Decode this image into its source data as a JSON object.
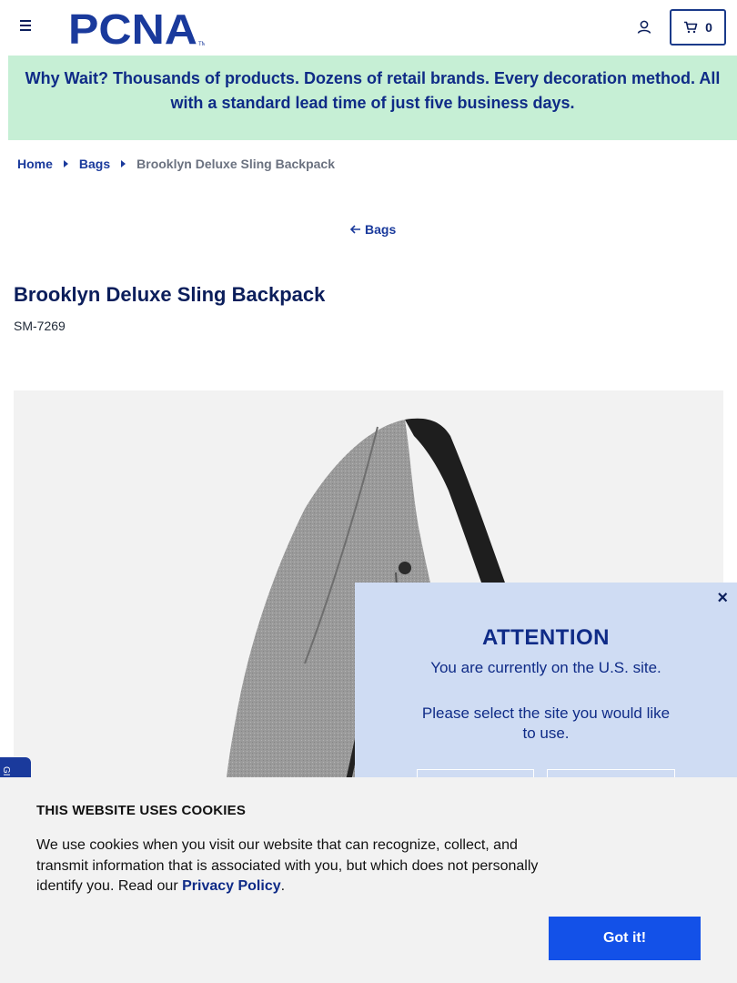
{
  "header": {
    "logo_text": "PCNA",
    "cart_count": "0"
  },
  "promo": {
    "text": "Why Wait? Thousands of products. Dozens of retail brands. Every decoration method. All with a standard lead time of just five business days."
  },
  "breadcrumb": {
    "items": [
      "Home",
      "Bags"
    ],
    "current": "Brooklyn Deluxe Sling Backpack"
  },
  "back_link": "Bags",
  "product": {
    "title": "Brooklyn Deluxe Sling Backpack",
    "sku": "SM-7269"
  },
  "attention": {
    "close": "×",
    "title": "ATTENTION",
    "message": "You are currently on the U.S. site.",
    "prompt": "Please select the site you would like to use."
  },
  "cookie": {
    "title": "THIS WEBSITE USES COOKIES",
    "text_before": "We use cookies when you visit our website that can recognize, collect, and transmit information that is associated with you, but which does not personally identify you. Read our ",
    "link": "Privacy Policy",
    "text_after": ".",
    "button": "Got it!"
  },
  "colors": {
    "brand_navy": "#0b1e5b",
    "link_blue": "#1a3a9c",
    "promo_bg": "#c6efd5",
    "modal_bg": "#cfdcf3",
    "cta_blue": "#1351e8"
  },
  "icons": [
    "menu-icon",
    "account-icon",
    "cart-icon",
    "back-arrow-icon",
    "close-icon",
    "chevron-right-icon"
  ]
}
